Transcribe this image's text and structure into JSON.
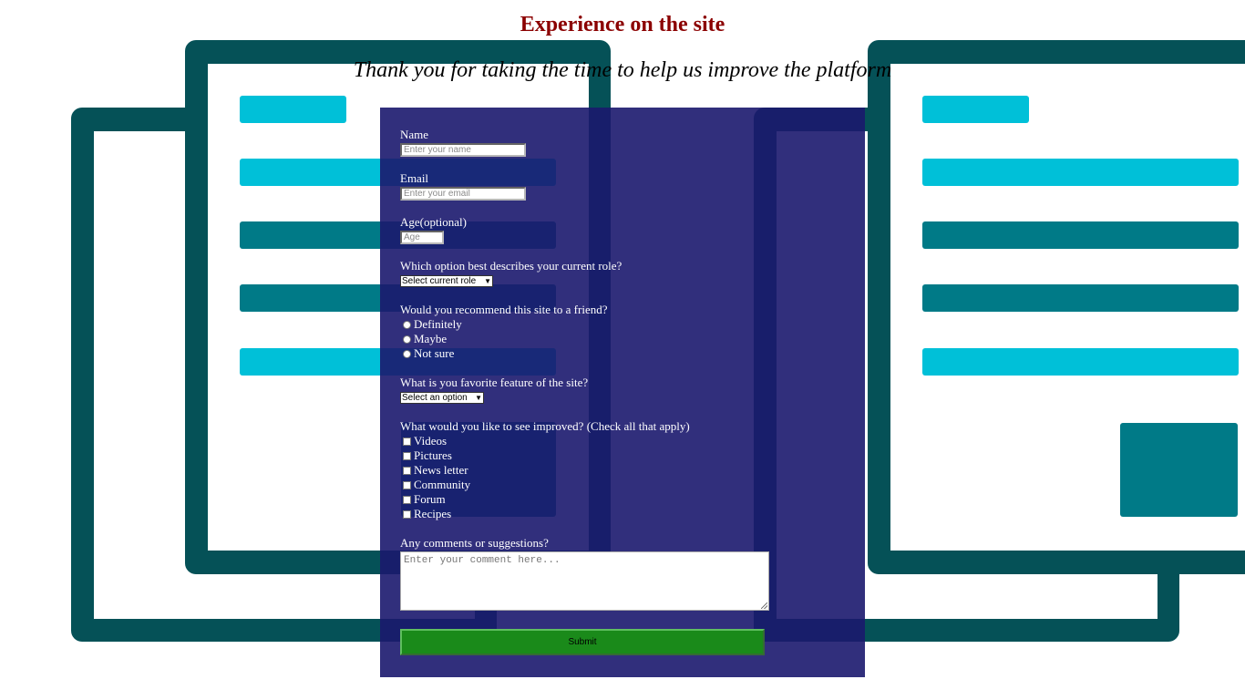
{
  "page": {
    "title": "Experience on the site",
    "subtitle": "Thank you for taking the time to help us improve the platform"
  },
  "colors": {
    "title": "#8b0000",
    "panel": "#1b186e",
    "frame": "#055157",
    "cyan_bar": "#00c0d8",
    "teal_bar": "#007a87",
    "submit": "#1a8a1a"
  },
  "form": {
    "name": {
      "label": "Name",
      "placeholder": "Enter your name"
    },
    "email": {
      "label": "Email",
      "placeholder": "Enter your email"
    },
    "age": {
      "label": "Age(optional)",
      "placeholder": "Age"
    },
    "role": {
      "label": "Which option best describes your current role?",
      "selected": "Select current role"
    },
    "recommend": {
      "label": "Would you recommend this site to a friend?",
      "options": [
        "Definitely",
        "Maybe",
        "Not sure"
      ]
    },
    "feature": {
      "label": "What is you favorite feature of the site?",
      "selected": "Select an option"
    },
    "improve": {
      "label": "What would you like to see improved? (Check all that apply)",
      "options": [
        "Videos",
        "Pictures",
        "News letter",
        "Community",
        "Forum",
        "Recipes"
      ]
    },
    "comments": {
      "label": "Any comments or suggestions?",
      "placeholder": "Enter your comment here..."
    },
    "submit_label": "Submit"
  }
}
